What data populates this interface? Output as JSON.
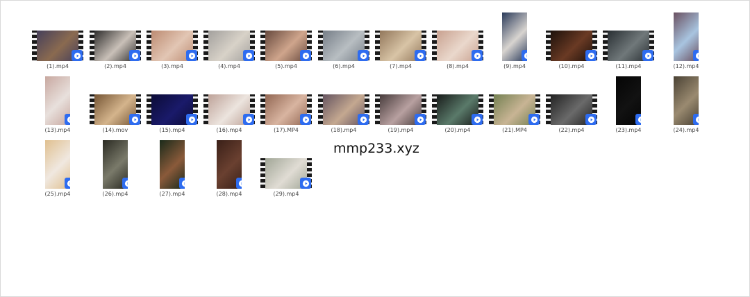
{
  "watermark": "mmp233.xyz",
  "files": [
    {
      "name": "(1).mp4",
      "c1": "#3d3a5c",
      "c2": "#8a6a50",
      "orientation": "landscape"
    },
    {
      "name": "(2).mp4",
      "c1": "#1b1b1b",
      "c2": "#c9c0b8",
      "orientation": "landscape"
    },
    {
      "name": "(3).mp4",
      "c1": "#b8846a",
      "c2": "#e2c6b4",
      "orientation": "landscape"
    },
    {
      "name": "(4).mp4",
      "c1": "#9c9a98",
      "c2": "#d8d2c8",
      "orientation": "landscape"
    },
    {
      "name": "(5).mp4",
      "c1": "#5a3e34",
      "c2": "#cfa58c",
      "orientation": "landscape"
    },
    {
      "name": "(6).mp4",
      "c1": "#6e7680",
      "c2": "#b8bec2",
      "orientation": "landscape"
    },
    {
      "name": "(7).mp4",
      "c1": "#8a6e52",
      "c2": "#d8c4a6",
      "orientation": "landscape"
    },
    {
      "name": "(8).mp4",
      "c1": "#c49a88",
      "c2": "#ead8cc",
      "orientation": "landscape"
    },
    {
      "name": "(9).mp4",
      "c1": "#2a3a5a",
      "c2": "#d8d4d0",
      "orientation": "portrait"
    },
    {
      "name": "(10).mp4",
      "c1": "#140c08",
      "c2": "#6a3a24",
      "orientation": "landscape"
    },
    {
      "name": "(11).mp4",
      "c1": "#20262a",
      "c2": "#70787a",
      "orientation": "landscape"
    },
    {
      "name": "(12).mp4",
      "c1": "#6a5060",
      "c2": "#a8c4e0",
      "orientation": "portrait"
    },
    {
      "name": "(13).mp4",
      "c1": "#c8a8a0",
      "c2": "#e8e0dc",
      "orientation": "portrait"
    },
    {
      "name": "(14).mov",
      "c1": "#6a4a2a",
      "c2": "#d4b48c",
      "orientation": "landscape"
    },
    {
      "name": "(15).mp4",
      "c1": "#0a0a30",
      "c2": "#1a1a6a",
      "orientation": "landscape"
    },
    {
      "name": "(16).mp4",
      "c1": "#b89a90",
      "c2": "#ece4de",
      "orientation": "landscape"
    },
    {
      "name": "(17).MP4",
      "c1": "#8a5e4a",
      "c2": "#d8b4a0",
      "orientation": "landscape"
    },
    {
      "name": "(18).mp4",
      "c1": "#5a4a5a",
      "c2": "#c4a890",
      "orientation": "landscape"
    },
    {
      "name": "(19).mp4",
      "c1": "#3a3030",
      "c2": "#b8a0a0",
      "orientation": "landscape"
    },
    {
      "name": "(20).mp4",
      "c1": "#101010",
      "c2": "#5a7a6a",
      "orientation": "landscape"
    },
    {
      "name": "(21).MP4",
      "c1": "#6a7a4a",
      "c2": "#c8b494",
      "orientation": "landscape"
    },
    {
      "name": "(22).mp4",
      "c1": "#1a1a1a",
      "c2": "#6a6a6a",
      "orientation": "landscape"
    },
    {
      "name": "(23).mp4",
      "c1": "#050505",
      "c2": "#121212",
      "orientation": "portrait"
    },
    {
      "name": "(24).mp4",
      "c1": "#4a4234",
      "c2": "#9a8a70",
      "orientation": "portrait"
    },
    {
      "name": "(25).mp4",
      "c1": "#e0c090",
      "c2": "#f0e8e0",
      "orientation": "portrait"
    },
    {
      "name": "(26).mp4",
      "c1": "#2a2a22",
      "c2": "#7a7a6a",
      "orientation": "portrait"
    },
    {
      "name": "(27).mp4",
      "c1": "#1a2a1a",
      "c2": "#8a5a3a",
      "orientation": "portrait"
    },
    {
      "name": "(28).mp4",
      "c1": "#3a2018",
      "c2": "#6a4030",
      "orientation": "portrait"
    },
    {
      "name": "(29).mp4",
      "c1": "#9aa090",
      "c2": "#e0dcd4",
      "orientation": "landscape"
    }
  ],
  "colors": {
    "play_badge": "#2e6cf0",
    "label_text": "#444444"
  }
}
